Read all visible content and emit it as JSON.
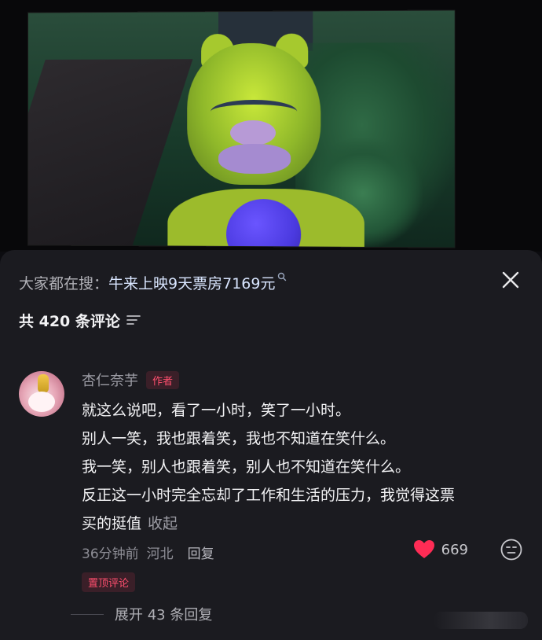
{
  "video": {},
  "search": {
    "prefix": "大家都在搜：",
    "query": "牛来上映9天票房7169元"
  },
  "comments_header": {
    "count_label": "共 420 条评论"
  },
  "comment": {
    "author": "杏仁奈芋",
    "author_badge": "作者",
    "lines": [
      "就这么说吧，看了一小时，笑了一小时。",
      "别人一笑，我也跟着笑，我也不知道在笑什么。",
      "我一笑，别人也跟着笑，别人也不知道在笑什么。",
      "反正这一小时完全忘却了工作和生活的压力，我觉得这票",
      "买的挺值"
    ],
    "collapse_label": "收起",
    "time": "36分钟前",
    "location": "河北",
    "reply_label": "回复",
    "like_count": "669",
    "pinned_label": "置顶评论",
    "expand_label": "展开 43 条回复"
  },
  "colors": {
    "panel_bg": "#1b1b20",
    "like_red": "#fe2c55",
    "badge_red": "#ff4f6e"
  }
}
